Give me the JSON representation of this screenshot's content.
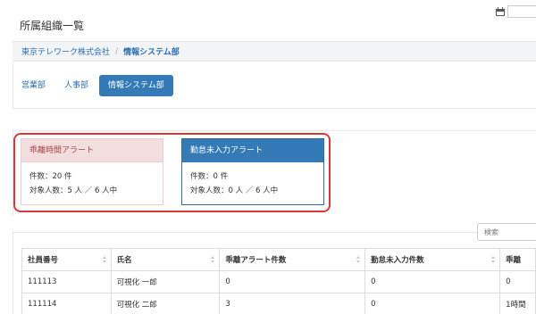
{
  "header": {
    "title": "所属組織一覧"
  },
  "breadcrumb": {
    "company": "東京テレワーク株式会社",
    "separator": "/",
    "current": "情報システム部"
  },
  "tabs": [
    {
      "label": "営業部",
      "active": false
    },
    {
      "label": "人事部",
      "active": false
    },
    {
      "label": "情報システム部",
      "active": true
    }
  ],
  "alerts": [
    {
      "title": "乖離時間アラート",
      "count_line": "件数：20 件",
      "target_line": "対象人数：5 人 ／ 6 人中",
      "color": "#f2dede"
    },
    {
      "title": "勤怠未入力アラート",
      "count_line": "件数：0 件",
      "target_line": "対象人数：0 人 ／ 6 人中",
      "color": "#337ab7"
    }
  ],
  "search": {
    "placeholder": "検索"
  },
  "table": {
    "columns": [
      "社員番号",
      "氏名",
      "乖離アラート件数",
      "勤怠未入力件数",
      "乖離"
    ],
    "rows": [
      [
        "111113",
        "可視化 一郎",
        "0",
        "0",
        "0"
      ],
      [
        "111114",
        "可視化 二郎",
        "3",
        "0",
        "1時間"
      ]
    ]
  }
}
